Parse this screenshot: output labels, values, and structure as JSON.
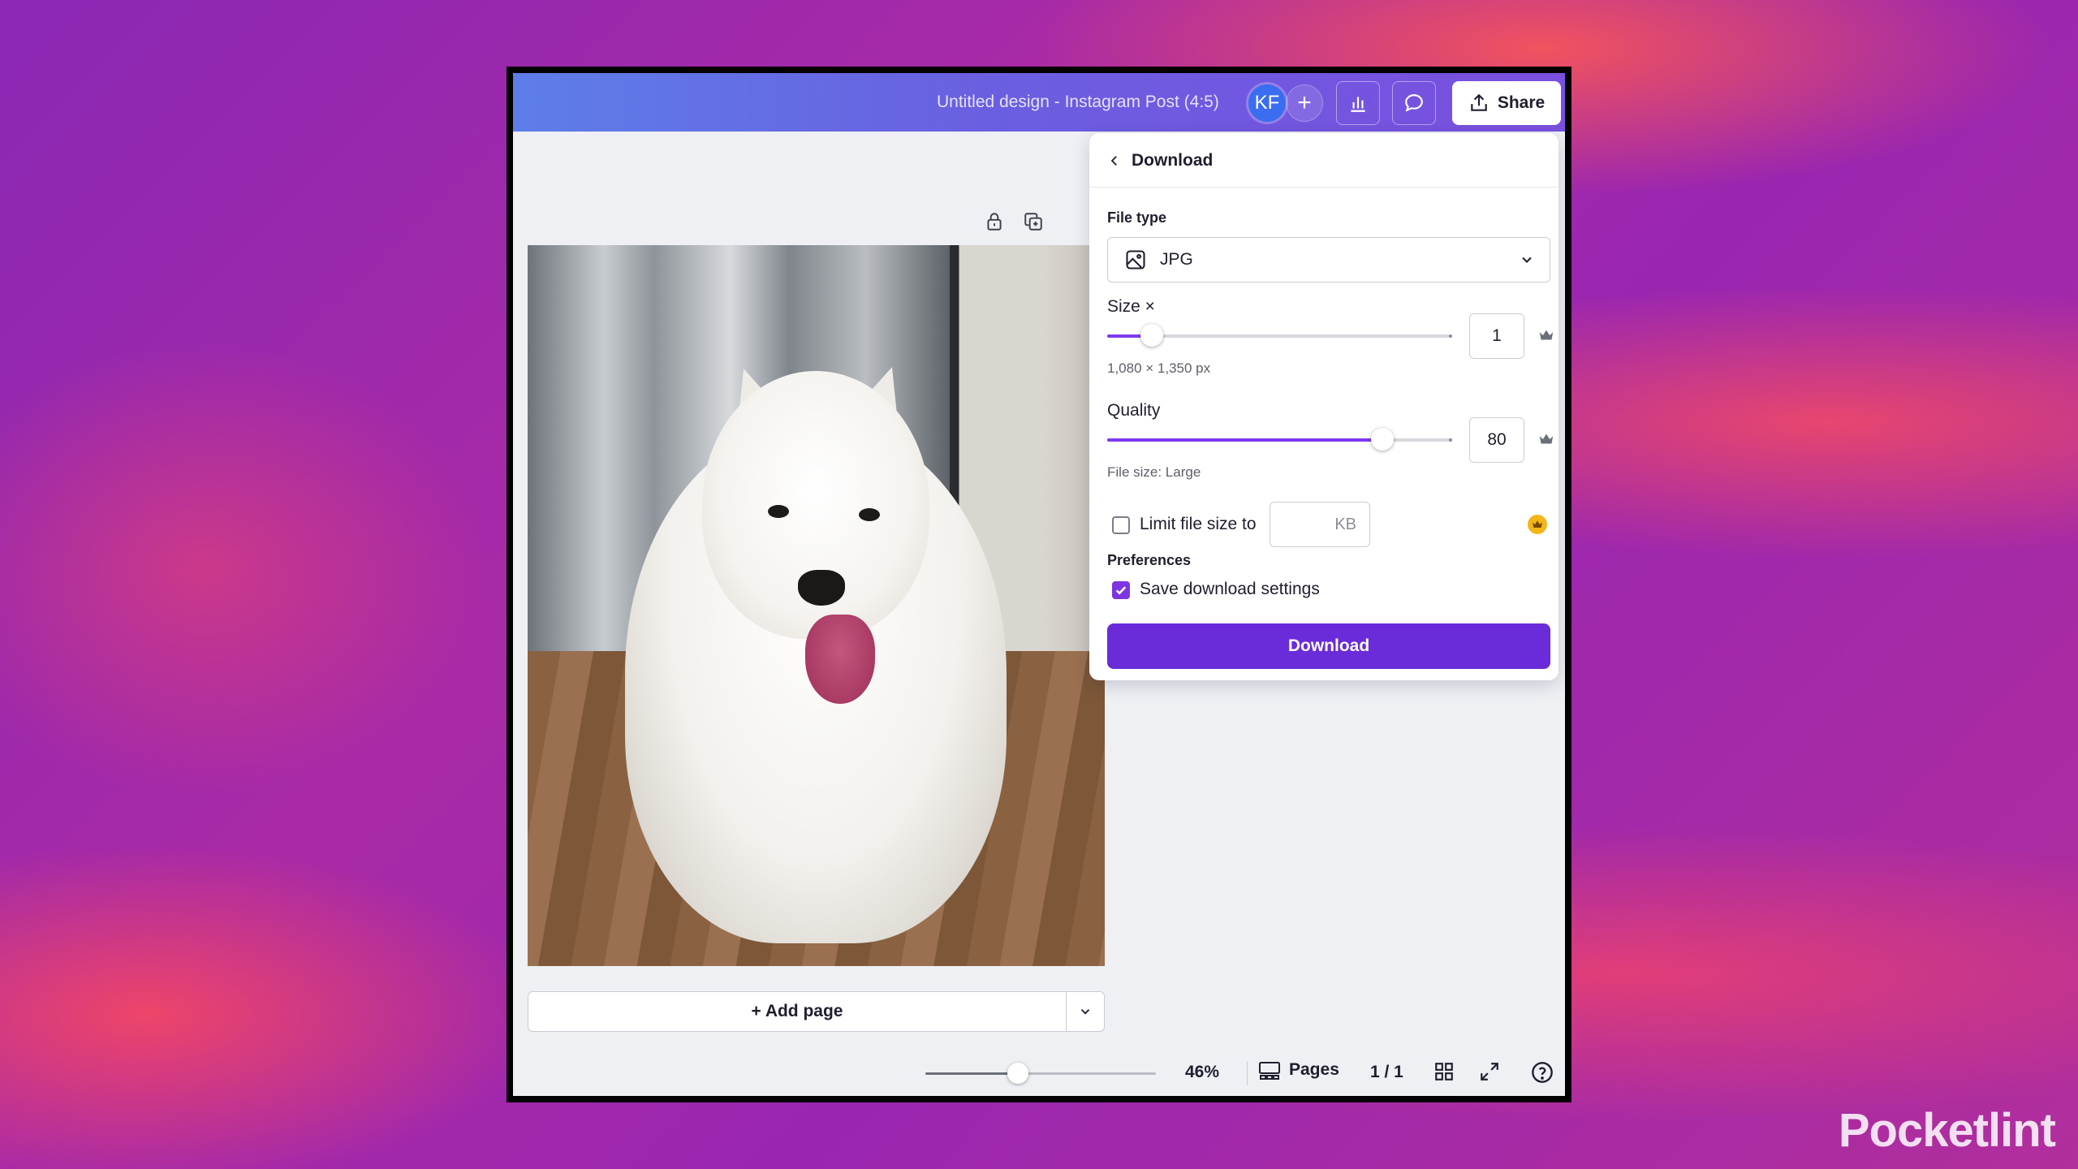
{
  "watermark": "Pocketlint",
  "app": {
    "title": "Untitled design - Instagram Post (4:5)",
    "avatar_initials": "KF",
    "add_label": "+",
    "share_label": "Share"
  },
  "canvas": {
    "add_page_label": "+ Add page"
  },
  "bottombar": {
    "zoom_value": 0.4,
    "zoom_label": "46%",
    "pages_label": "Pages",
    "page_count": "1 / 1"
  },
  "download_panel": {
    "back_label": "Download",
    "file_type_label": "File type",
    "file_type_value": "JPG",
    "size_label": "Size ×",
    "size_value": "1",
    "size_slider_fraction": 0.13,
    "dimensions": "1,080 × 1,350 px",
    "quality_label": "Quality",
    "quality_value": "80",
    "quality_slider_fraction": 0.8,
    "file_size_text": "File size: Large",
    "limit_label": "Limit file size to",
    "limit_checked": false,
    "limit_unit": "KB",
    "preferences_label": "Preferences",
    "save_settings_label": "Save download settings",
    "save_settings_checked": true,
    "download_button": "Download"
  },
  "colors": {
    "accent": "#6a2bd9",
    "slider": "#7c3aed",
    "premium_crown": "#f2b61b"
  }
}
